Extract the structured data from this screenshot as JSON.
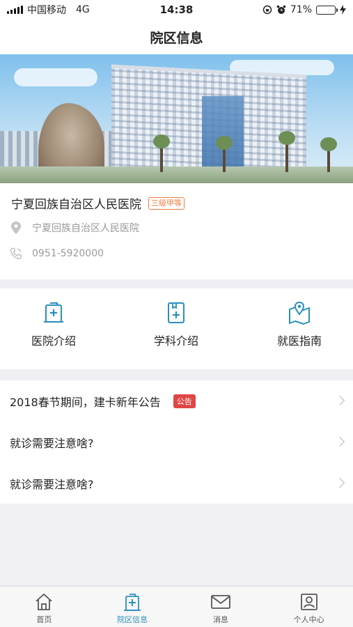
{
  "status_bar": {
    "carrier": "中国移动",
    "network": "4G",
    "time": "14:38",
    "battery_pct_text": "71%",
    "battery_level": 0.71
  },
  "nav": {
    "title": "院区信息"
  },
  "hospital": {
    "name": "宁夏回族自治区人民医院",
    "grade": "三级甲等",
    "address": "宁夏回族自治区人民医院",
    "phone": "0951-5920000"
  },
  "quick_links": [
    {
      "label": "医院介绍",
      "icon": "hospital-intro-icon"
    },
    {
      "label": "学科介绍",
      "icon": "department-intro-icon"
    },
    {
      "label": "就医指南",
      "icon": "map-guide-icon"
    }
  ],
  "notices": [
    {
      "title": "2018春节期间，建卡新年公告",
      "tag": "公告"
    },
    {
      "title": "就诊需要注意啥?"
    },
    {
      "title": "就诊需要注意啥?"
    }
  ],
  "tabs": [
    {
      "label": "首页",
      "icon": "home-icon"
    },
    {
      "label": "院区信息",
      "icon": "campus-icon"
    },
    {
      "label": "消息",
      "icon": "mail-icon"
    },
    {
      "label": "个人中心",
      "icon": "profile-icon"
    }
  ],
  "colors": {
    "accent": "#2a8fbd",
    "grade_tag": "#f07b3f",
    "notice_tag": "#e04646",
    "battery": "#4cd964"
  }
}
